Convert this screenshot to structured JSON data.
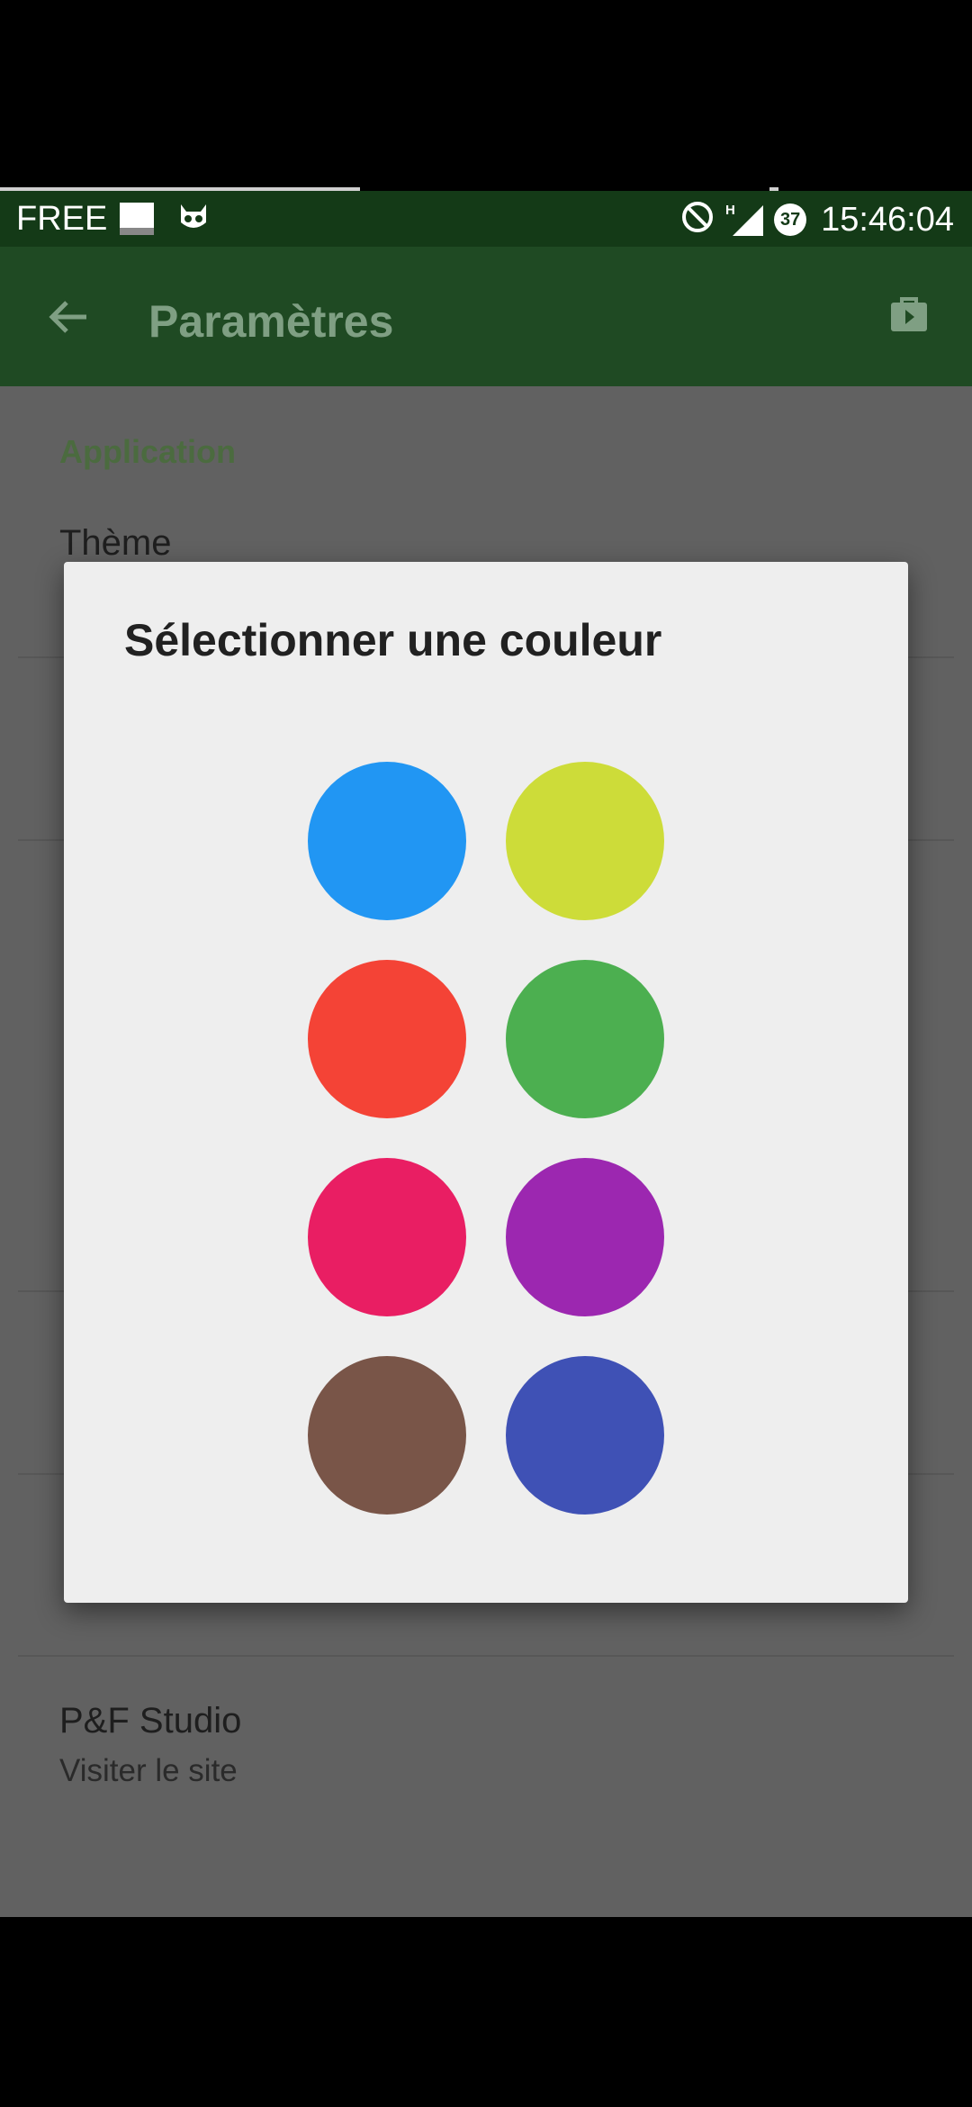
{
  "status_bar": {
    "carrier": "FREE",
    "time": "15:46:04",
    "network_label": "H",
    "badge": "37",
    "icons": [
      "orange-logo-icon",
      "cyanogen-cat-icon",
      "do-not-disturb-icon",
      "signal-icon",
      "notification-badge-icon"
    ]
  },
  "app_bar": {
    "title": "Paramètres",
    "back_icon": "arrow-back-icon",
    "action_icon": "shopping-bag-icon",
    "color": "#1f4a23"
  },
  "settings": {
    "section": "Application",
    "theme_title": "Thème",
    "studio_title": "P&F Studio",
    "studio_sub": "Visiter le site"
  },
  "dialog": {
    "title": "Sélectionner une couleur",
    "colors": [
      {
        "name": "blue",
        "hex": "#2196f3"
      },
      {
        "name": "lime",
        "hex": "#cddc39"
      },
      {
        "name": "red",
        "hex": "#f44336"
      },
      {
        "name": "green",
        "hex": "#4caf50"
      },
      {
        "name": "pink",
        "hex": "#e91e63"
      },
      {
        "name": "purple",
        "hex": "#9c27b0"
      },
      {
        "name": "brown",
        "hex": "#795548"
      },
      {
        "name": "indigo",
        "hex": "#3f51b5"
      }
    ]
  }
}
